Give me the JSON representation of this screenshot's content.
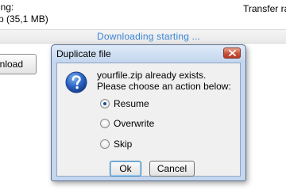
{
  "background": {
    "line1": "ing:",
    "line2": "p (35,1 MB)",
    "transfer_label": "Transfer rat",
    "status_text": "Downloading starting ...",
    "download_button": "wnload"
  },
  "dialog": {
    "title": "Duplicate file",
    "message_line1": "yourfile.zip already exists.",
    "message_line2": "Please choose an action below:",
    "options": [
      {
        "label": "Resume",
        "checked": true
      },
      {
        "label": "Overwrite",
        "checked": false
      },
      {
        "label": "Skip",
        "checked": false
      }
    ],
    "ok_label": "Ok",
    "cancel_label": "Cancel",
    "icon": "question-icon"
  },
  "colors": {
    "status_blue": "#3a86d6",
    "dialog_frame": "#c5d7ef",
    "close_red": "#c9503a"
  }
}
